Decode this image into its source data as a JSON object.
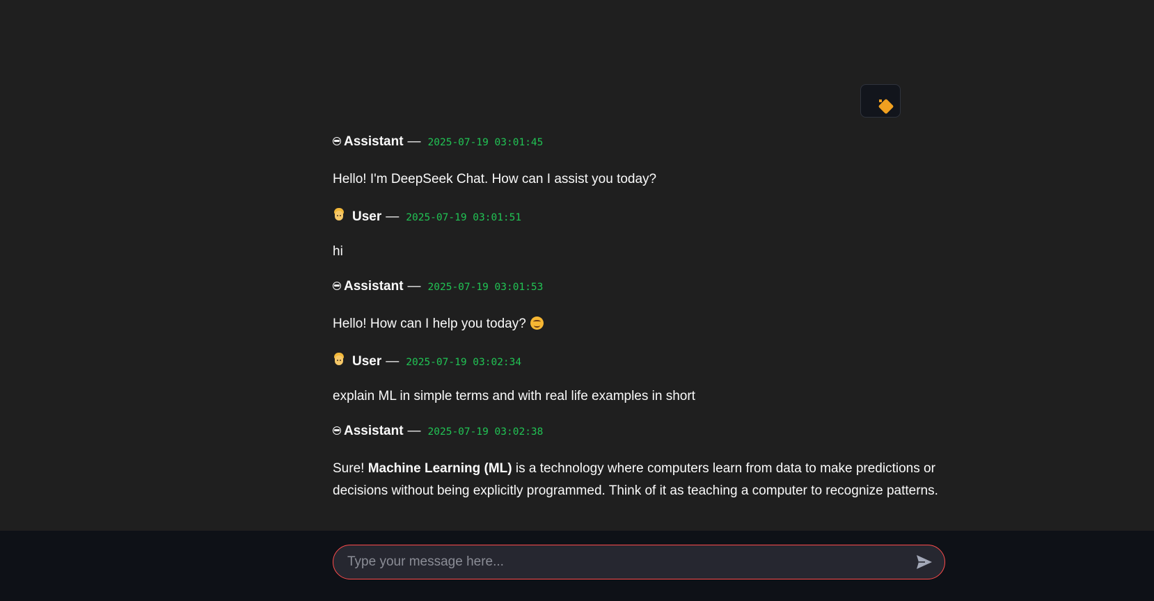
{
  "theme_toggle": {
    "icon": "sun-icon"
  },
  "messages": [
    {
      "role": "assistant",
      "name": "Assistant",
      "dash": "—",
      "timestamp": "2025-07-19 03:01:45",
      "text": "Hello! I'm DeepSeek Chat. How can I assist you today?"
    },
    {
      "role": "user",
      "name": "User",
      "dash": "—",
      "timestamp": "2025-07-19 03:01:51",
      "text": "hi"
    },
    {
      "role": "assistant",
      "name": "Assistant",
      "dash": "—",
      "timestamp": "2025-07-19 03:01:53",
      "text": "Hello! How can I help you today?"
    },
    {
      "role": "user",
      "name": "User",
      "dash": "—",
      "timestamp": "2025-07-19 03:02:34",
      "text": "explain ML in simple terms and with real life examples in short"
    },
    {
      "role": "assistant",
      "name": "Assistant",
      "dash": "—",
      "timestamp": "2025-07-19 03:02:38",
      "text_prefix": "Sure! ",
      "text_bold": "Machine Learning (ML)",
      "text_suffix": " is a technology where computers learn from data to make predictions or decisions without being explicitly programmed. Think of it as teaching a computer to recognize patterns."
    }
  ],
  "input": {
    "placeholder": "Type your message here...",
    "value": ""
  },
  "colors": {
    "accent": "#ff4b4b",
    "timestamp": "#21c354",
    "background": "#1f1f1f",
    "input_bar": "#0e1117"
  }
}
